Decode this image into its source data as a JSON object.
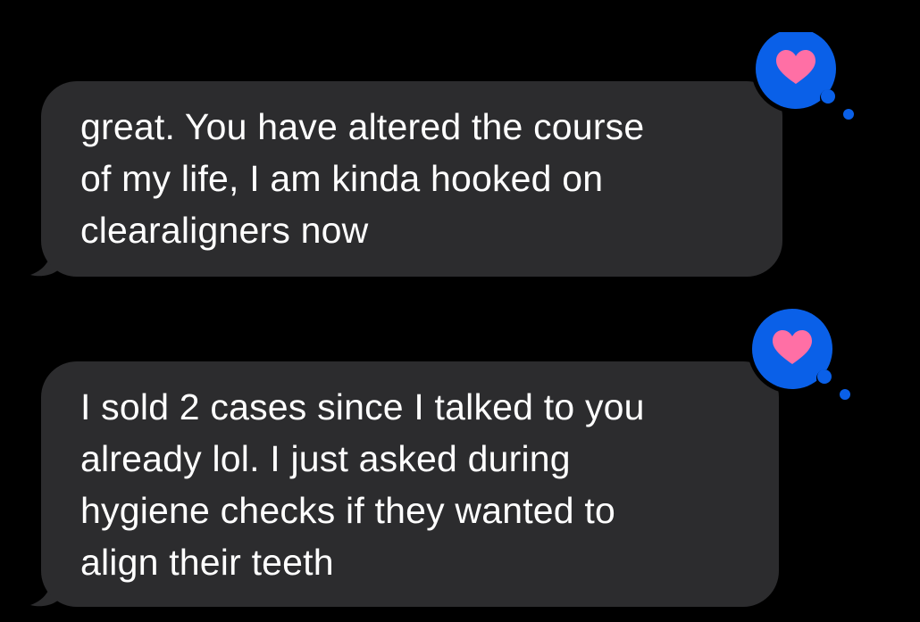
{
  "colors": {
    "background": "#000000",
    "bubble": "#2c2c2e",
    "text": "#ffffff",
    "tapback_bubble": "#0a60e8",
    "heart": "#ff6fa5"
  },
  "messages": [
    {
      "lines": [
        "great. You have altered the course",
        "of my life, I am kinda hooked on",
        "clearaligners now"
      ],
      "tapback_icon": "heart-icon"
    },
    {
      "lines": [
        "I sold 2 cases since I talked to you",
        "already lol. I just asked during",
        "hygiene checks if they wanted to",
        "align their teeth"
      ],
      "tapback_icon": "heart-icon"
    }
  ]
}
